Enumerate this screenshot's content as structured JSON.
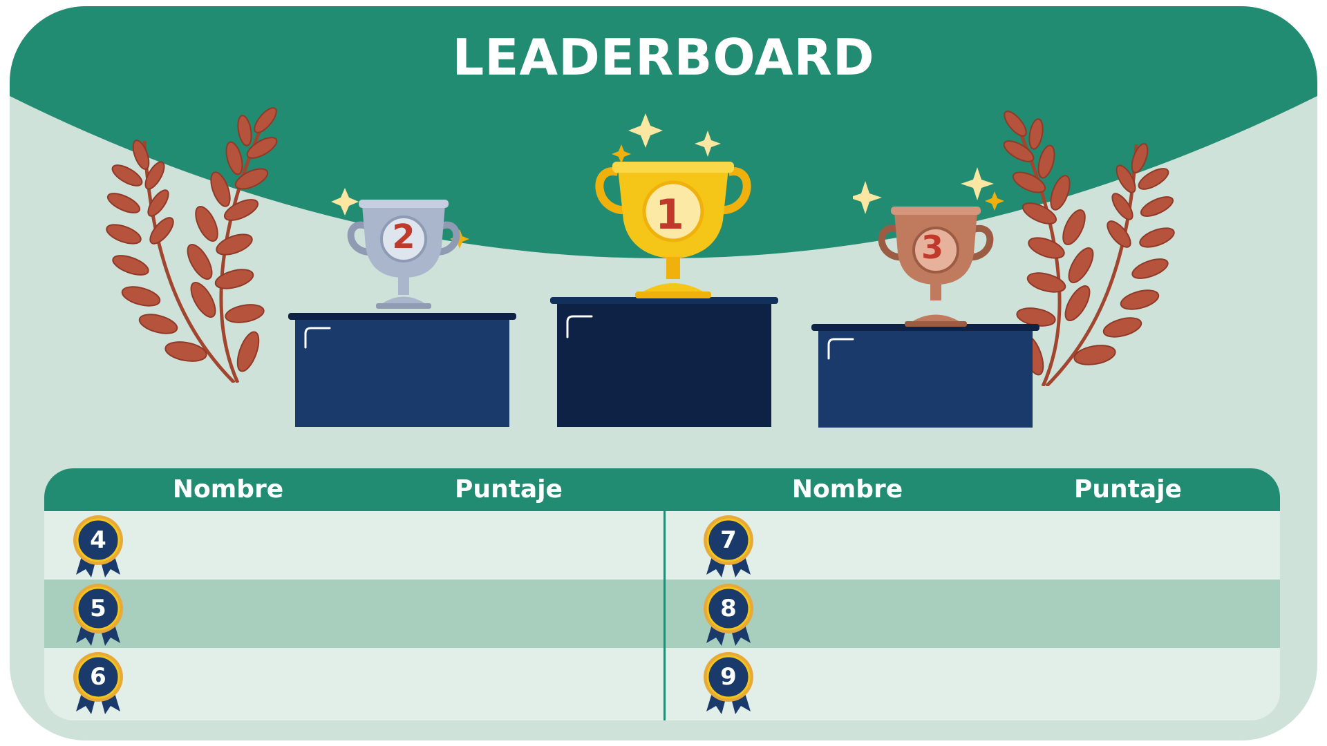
{
  "header": {
    "title": "LEADERBOARD"
  },
  "podium": [
    {
      "place": "2",
      "label": "2"
    },
    {
      "place": "1",
      "label": "1"
    },
    {
      "place": "3",
      "label": "3"
    }
  ],
  "table": {
    "columns": [
      "Nombre",
      "Puntaje",
      "Nombre",
      "Puntaje"
    ],
    "left_rows": [
      {
        "rank": "4",
        "name": "",
        "score": ""
      },
      {
        "rank": "5",
        "name": "",
        "score": ""
      },
      {
        "rank": "6",
        "name": "",
        "score": ""
      }
    ],
    "right_rows": [
      {
        "rank": "7",
        "name": "",
        "score": ""
      },
      {
        "rank": "8",
        "name": "",
        "score": ""
      },
      {
        "rank": "9",
        "name": "",
        "score": ""
      }
    ]
  },
  "colors": {
    "header_green": "#228c72",
    "background_mint": "#cfe2da",
    "podium_navy": "#1a3a6b",
    "podium_dark_navy": "#0d2244",
    "gold": "#f5c518",
    "silver": "#a9b6cc",
    "bronze": "#c07a5e",
    "laurel": "#b5533c"
  },
  "icons": [
    "laurel-left-icon",
    "laurel-right-icon",
    "silver-trophy-icon",
    "gold-trophy-icon",
    "bronze-trophy-icon",
    "sparkle-icon",
    "medal-icon"
  ]
}
